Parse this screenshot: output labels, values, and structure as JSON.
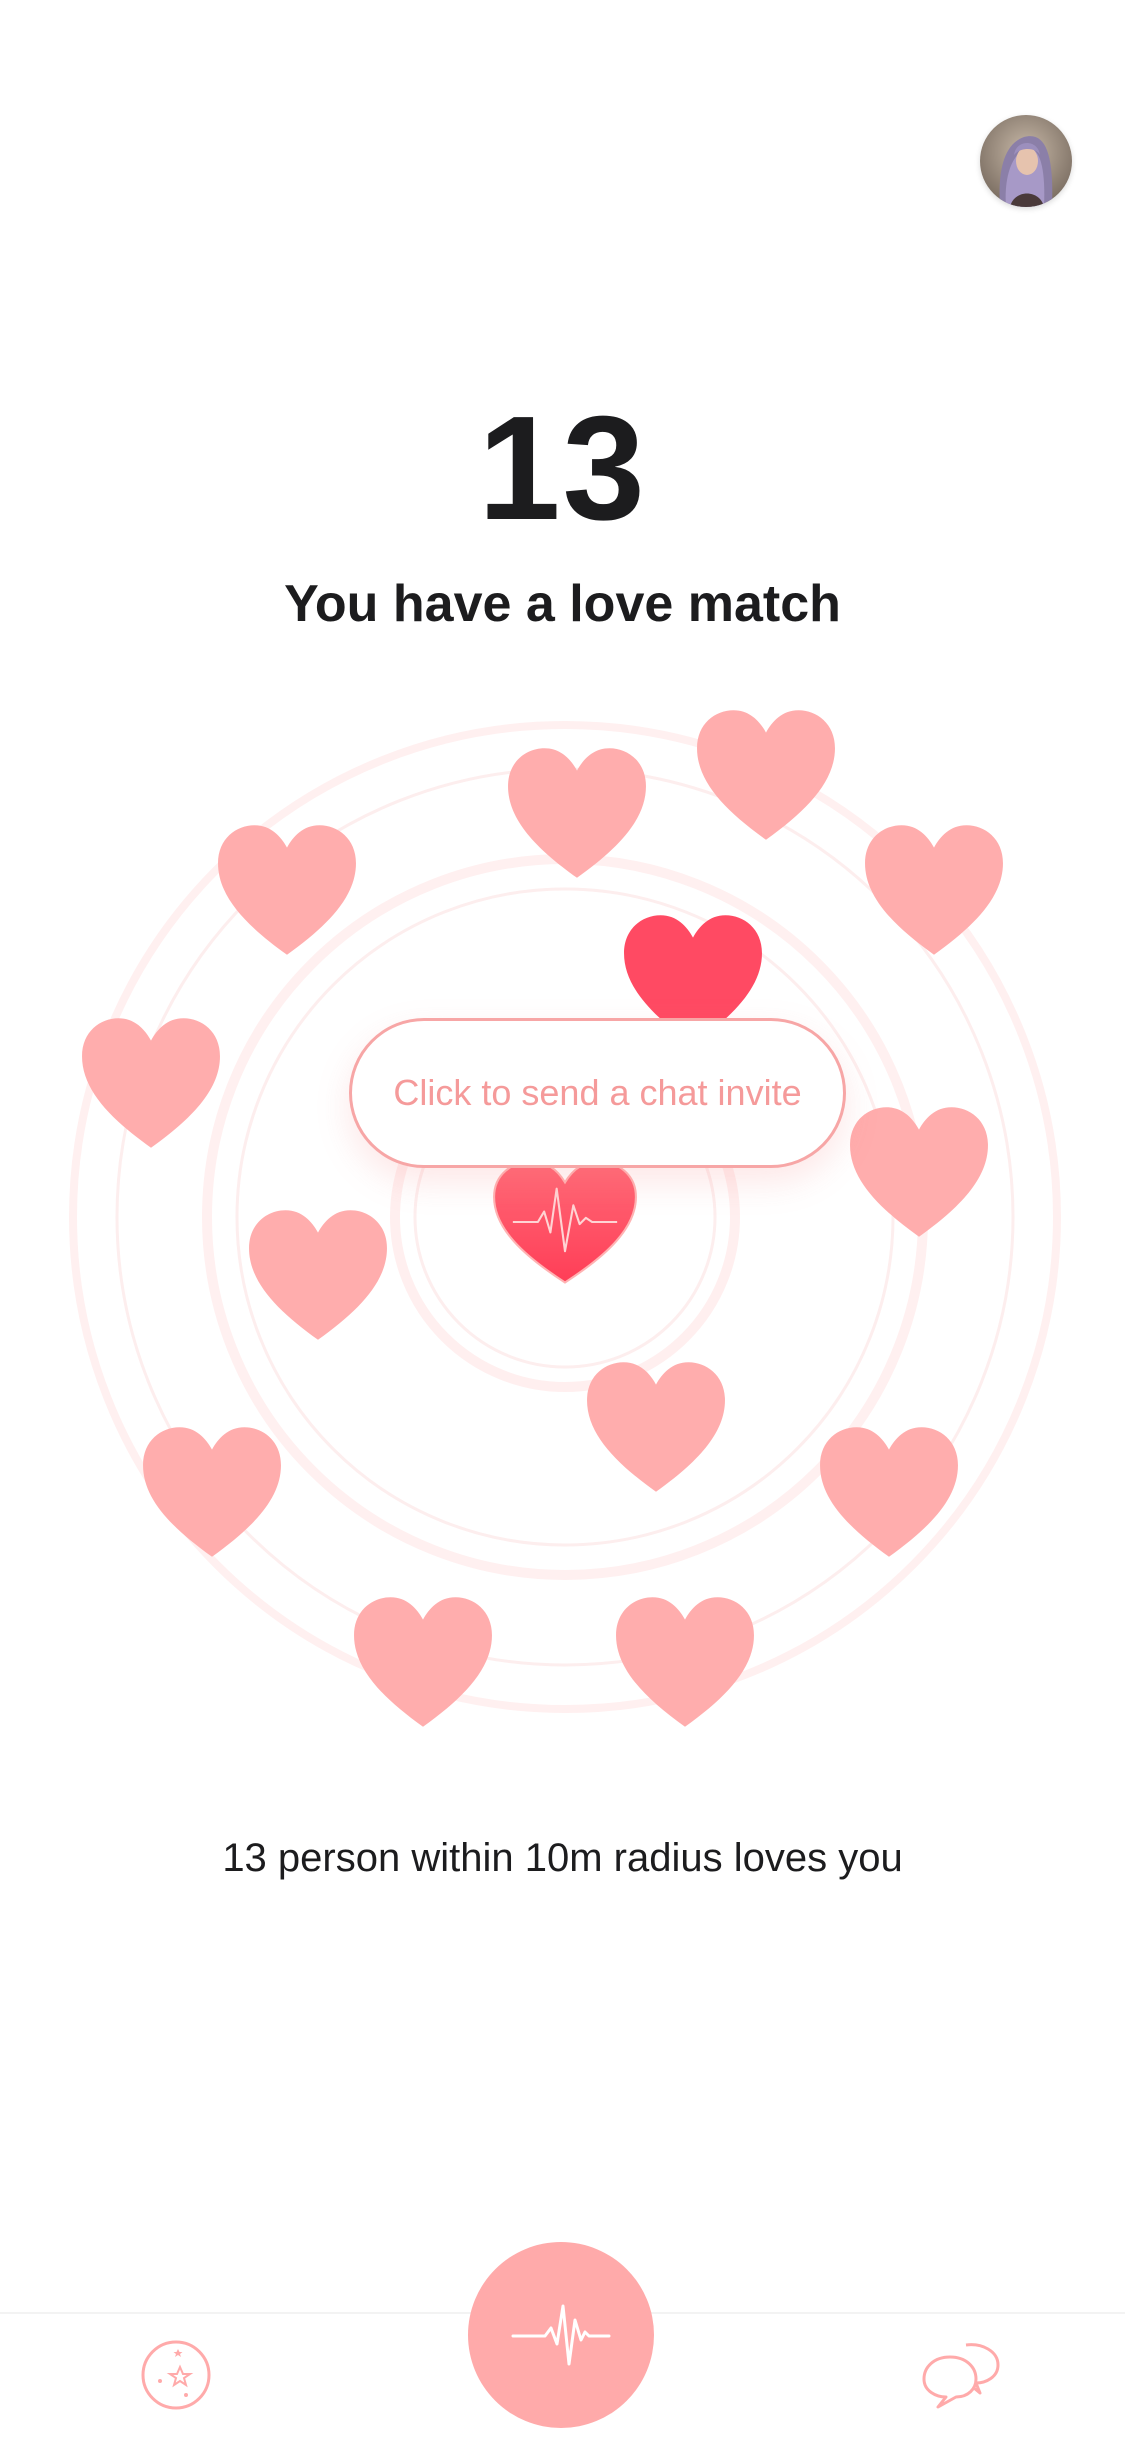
{
  "header": {
    "avatar_icon": "user-avatar"
  },
  "match": {
    "count": "13",
    "title": "You have a love match"
  },
  "radar": {
    "invite_label": "Click to send a chat invite",
    "center_icon": "heartbeat-heart-icon",
    "nearby_hearts_count": 13,
    "colors": {
      "heart": "#ffadad",
      "heart_active": "#ff4a63",
      "ring": "#ffeaea"
    }
  },
  "footer_text": "13 person within 10m radius loves you",
  "tabbar": {
    "left_icon": "discover-stars-icon",
    "center_icon": "heartbeat-icon",
    "right_icon": "chat-bubbles-icon",
    "accent": "#ffaaaa"
  }
}
